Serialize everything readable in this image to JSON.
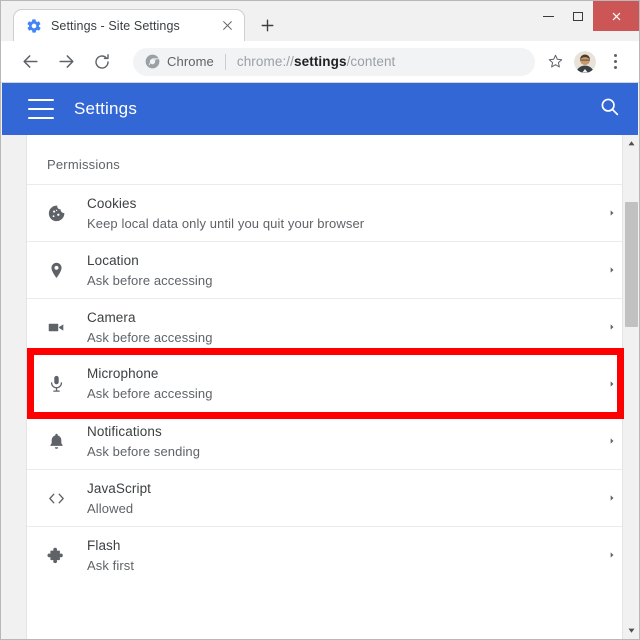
{
  "window": {
    "controls": {
      "minimize": "minimize",
      "maximize": "maximize",
      "close": "close"
    }
  },
  "tab": {
    "title": "Settings - Site Settings",
    "favicon": "gear-icon",
    "close_label": "Close tab",
    "newtab_label": "New tab"
  },
  "toolbar": {
    "back": "Back",
    "forward": "Forward",
    "reload": "Reload",
    "chip_label": "Chrome",
    "url_prefix": "chrome://",
    "url_bold": "settings",
    "url_suffix": "/content",
    "url_full": "chrome://settings/content",
    "bookmark": "Bookmark this page",
    "profile": "Profile",
    "menu": "Customize and control Google Chrome"
  },
  "settings_header": {
    "menu_label": "Main menu",
    "title": "Settings",
    "search_label": "Search settings"
  },
  "content": {
    "section_title": "Permissions",
    "rows": [
      {
        "icon": "cookie-icon",
        "title": "Cookies",
        "subtitle": "Keep local data only until you quit your browser",
        "highlighted": false
      },
      {
        "icon": "location-pin-icon",
        "title": "Location",
        "subtitle": "Ask before accessing",
        "highlighted": false
      },
      {
        "icon": "camera-icon",
        "title": "Camera",
        "subtitle": "Ask before accessing",
        "highlighted": false
      },
      {
        "icon": "microphone-icon",
        "title": "Microphone",
        "subtitle": "Ask before accessing",
        "highlighted": true
      },
      {
        "icon": "bell-icon",
        "title": "Notifications",
        "subtitle": "Ask before sending",
        "highlighted": false
      },
      {
        "icon": "code-brackets-icon",
        "title": "JavaScript",
        "subtitle": "Allowed",
        "highlighted": false
      },
      {
        "icon": "puzzle-piece-icon",
        "title": "Flash",
        "subtitle": "Ask first",
        "highlighted": false
      }
    ]
  },
  "scrollbar": {
    "up_label": "Scroll up",
    "down_label": "Scroll down",
    "thumb_label": "Scroll thumb"
  },
  "colors": {
    "accent_blue": "#3367d6",
    "highlight_red": "#ff0000",
    "close_button_red": "#cc5555",
    "text_primary": "#3c4043",
    "text_secondary": "#5f6368"
  }
}
